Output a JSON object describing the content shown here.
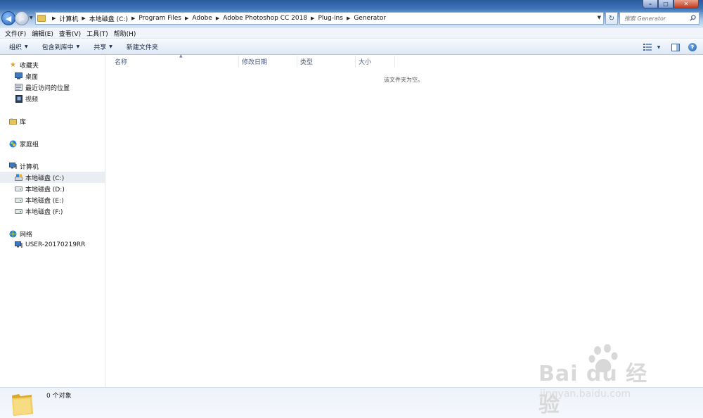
{
  "window": {
    "controls": {
      "minimize": "–",
      "maximize": "□",
      "close": "✕"
    }
  },
  "address": {
    "breadcrumbs": [
      "计算机",
      "本地磁盘 (C:)",
      "Program Files",
      "Adobe",
      "Adobe Photoshop CC 2018",
      "Plug-ins",
      "Generator"
    ],
    "search_placeholder": "搜索 Generator"
  },
  "menubar": {
    "items": [
      "文件(F)",
      "编辑(E)",
      "查看(V)",
      "工具(T)",
      "帮助(H)"
    ]
  },
  "toolbar": {
    "organize": "组织",
    "include_library": "包含到库中",
    "share": "共享",
    "new_folder": "新建文件夹"
  },
  "sidebar": {
    "favorites": {
      "label": "收藏夹",
      "items": [
        "桌面",
        "最近访问的位置",
        "视频"
      ]
    },
    "libraries": {
      "label": "库"
    },
    "homegroup": {
      "label": "家庭组"
    },
    "computer": {
      "label": "计算机",
      "items": [
        "本地磁盘 (C:)",
        "本地磁盘 (D:)",
        "本地磁盘 (E:)",
        "本地磁盘 (F:)"
      ],
      "selected_index": 0
    },
    "network": {
      "label": "网络",
      "items": [
        "USER-20170219RR"
      ]
    }
  },
  "columns": [
    "名称",
    "修改日期",
    "类型",
    "大小"
  ],
  "empty_message": "该文件夹为空。",
  "status": {
    "count": "0 个对象"
  },
  "watermark": {
    "brand": "Bai du 经验",
    "url": "jingyan.baidu.com"
  },
  "colors": {
    "accent": "#3d73b8",
    "folder": "#e8c35a",
    "selected": "#eaeef3"
  }
}
